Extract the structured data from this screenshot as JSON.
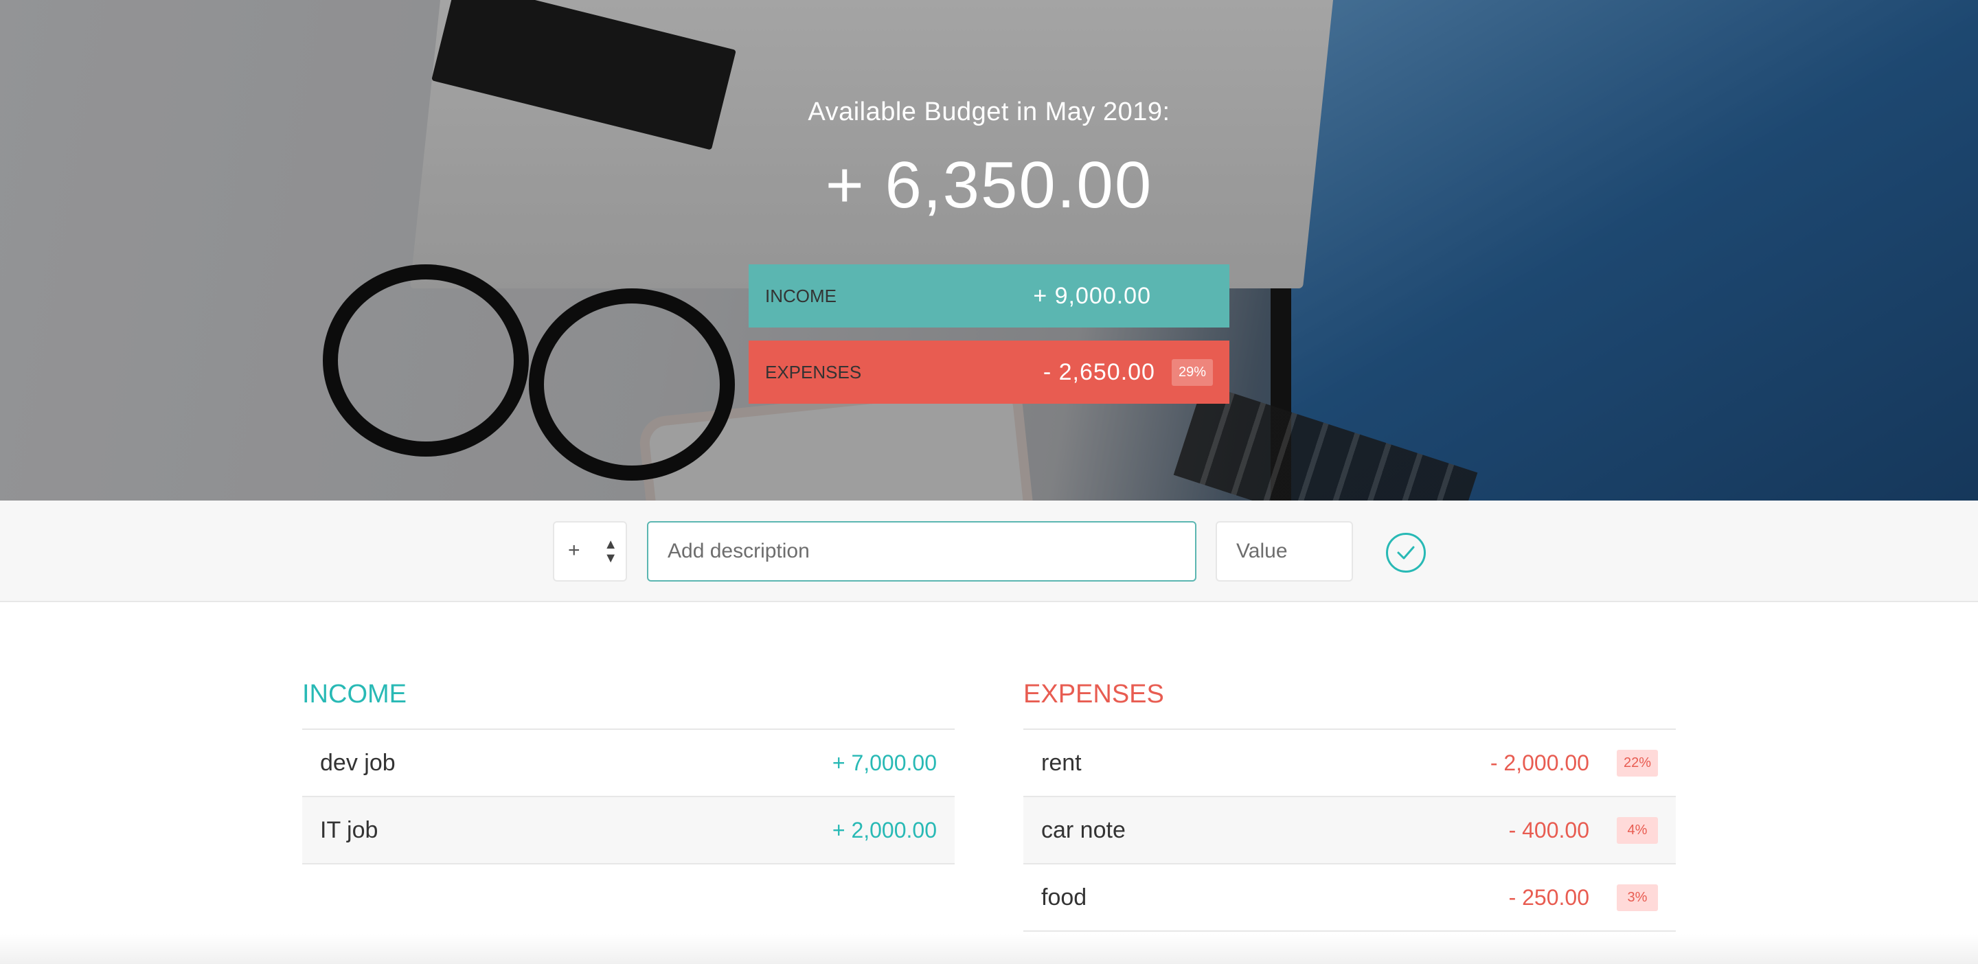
{
  "header": {
    "title": "Available Budget in May 2019:",
    "budget": "+ 6,350.00",
    "income_label": "Income",
    "income_value": "+ 9,000.00",
    "expenses_label": "Expenses",
    "expenses_value": "- 2,650.00",
    "expenses_percent": "29%"
  },
  "add_bar": {
    "type_selected": "+",
    "description_placeholder": "Add description",
    "description_value": "",
    "value_placeholder": "Value",
    "value_value": ""
  },
  "income": {
    "title": "Income",
    "items": [
      {
        "description": "dev job",
        "value": "+ 7,000.00"
      },
      {
        "description": "IT job",
        "value": "+ 2,000.00"
      }
    ]
  },
  "expenses": {
    "title": "Expenses",
    "items": [
      {
        "description": "rent",
        "value": "- 2,000.00",
        "percent": "22%"
      },
      {
        "description": "car note",
        "value": "- 400.00",
        "percent": "4%"
      },
      {
        "description": "food",
        "value": "- 250.00",
        "percent": "3%"
      }
    ]
  },
  "colors": {
    "income": "#28b9b5",
    "expenses": "#e85c51",
    "income_box": "#5bb6b1",
    "expenses_box": "#e85c51"
  },
  "icons": {
    "add_button": "checkmark-circle-icon",
    "type_select": "up-down-arrows-icon"
  }
}
